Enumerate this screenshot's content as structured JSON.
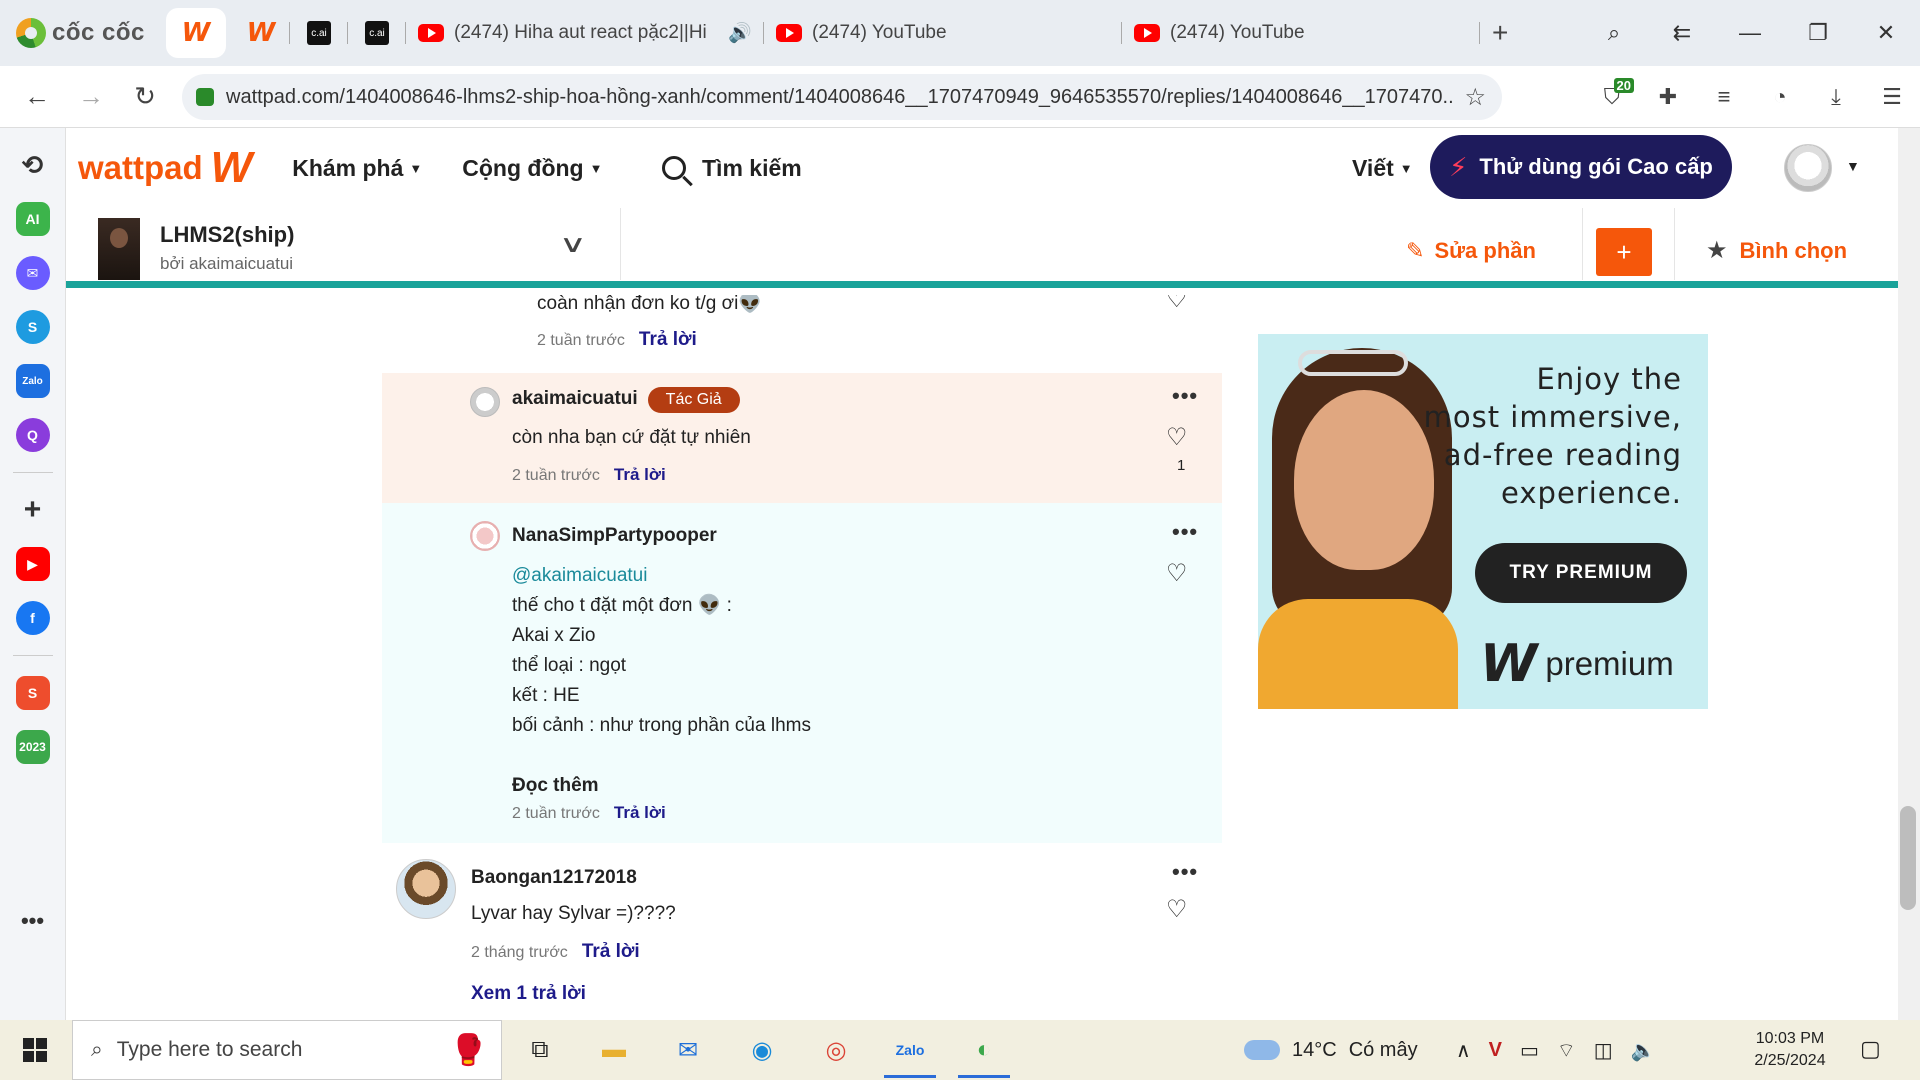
{
  "browser": {
    "brand": "cốc cốc",
    "tabs": [
      {
        "icon": "wattpad-icon",
        "label": ""
      },
      {
        "icon": "wattpad-icon",
        "label": ""
      },
      {
        "icon": "cai-icon",
        "label": "c.ai"
      },
      {
        "icon": "cai-icon",
        "label": "c.ai"
      },
      {
        "icon": "youtube-icon",
        "label": "(2474) Hiha aut react pặc2||Hi"
      },
      {
        "icon": "youtube-icon",
        "label": "(2474) YouTube"
      },
      {
        "icon": "youtube-icon",
        "label": "(2474) YouTube"
      }
    ],
    "url": "wattpad.com/1404008646-lhms2-ship-hoa-hồng-xanh/comment/1404008646__1707470949_9646535570/replies/1404008646__1707470...",
    "extension_badge": "20"
  },
  "wattpad": {
    "logo_text": "wattpad",
    "nav": {
      "explore": "Khám phá",
      "community": "Cộng đồng",
      "search": "Tìm kiếm",
      "write": "Viết",
      "premium": "Thử dùng gói Cao cấp"
    },
    "story": {
      "title": "LHMS2(ship)",
      "by": "bởi akaimaicuatui",
      "edit": "Sửa phần",
      "add": "+",
      "vote": "Bình chọn"
    },
    "comments": {
      "c1": {
        "text": "coàn nhận đơn ko t/g ơi👽",
        "time": "2 tuần trước",
        "reply": "Trả lời"
      },
      "c2": {
        "name": "akaimaicuatui",
        "badge": "Tác Giả",
        "text": "còn nha bạn cứ đặt tự nhiên",
        "time": "2 tuần trước",
        "reply": "Trả lời",
        "likes": "1"
      },
      "c3": {
        "name": "NanaSimpPartypooper",
        "mention": "@akaimaicuatui",
        "lines": [
          "thế cho t đặt một đơn 👽 :",
          "Akai x Zio",
          "thể loại : ngọt",
          "kết : HE",
          "bối cảnh : như trong phần của lhms"
        ],
        "more": "Đọc thêm",
        "time": "2 tuần trước",
        "reply": "Trả lời"
      },
      "c4": {
        "name": "Baongan12172018",
        "text": "Lyvar hay Sylvar  =)????",
        "time": "2 tháng trước",
        "reply": "Trả lời",
        "view_replies": "Xem 1 trả lời"
      }
    },
    "ad": {
      "lines": [
        "Enjoy the",
        "most immersive,",
        "ad-free reading",
        "experience."
      ],
      "button": "TRY PREMIUM",
      "brand": "premium"
    }
  },
  "taskbar": {
    "search_placeholder": "Type here to search",
    "weather": {
      "temp": "14°C",
      "desc": "Có mây"
    },
    "time": "10:03 PM",
    "date": "2/25/2024"
  },
  "colors": {
    "wattpad_orange": "#f5570b",
    "premium_navy": "#1e1b5c",
    "teal_bar": "#1aa39a"
  }
}
